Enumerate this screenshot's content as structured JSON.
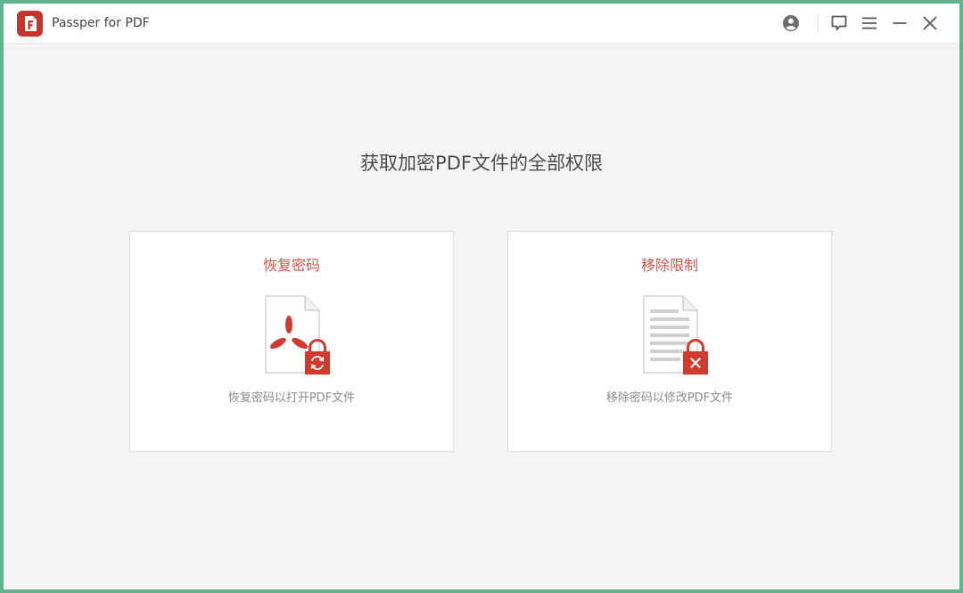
{
  "app": {
    "title": "Passper for PDF",
    "logo_icon": "passper-pdf-logo",
    "brand_color": "#c8342b"
  },
  "titlebar": {
    "buttons": [
      {
        "icon": "account-icon"
      },
      {
        "icon": "feedback-icon"
      },
      {
        "icon": "menu-icon"
      },
      {
        "icon": "minimize-icon"
      },
      {
        "icon": "close-icon"
      }
    ]
  },
  "main": {
    "headline": "获取加密PDF文件的全部权限",
    "cards": [
      {
        "title": "恢复密码",
        "icon": "pdf-lock-refresh-icon",
        "description": "恢复密码以打开PDF文件"
      },
      {
        "title": "移除限制",
        "icon": "document-lock-remove-icon",
        "description": "移除密码以修改PDF文件"
      }
    ]
  },
  "colors": {
    "accent": "#d2574d",
    "frame": "#5fb38f",
    "background": "#f4f4f4"
  }
}
